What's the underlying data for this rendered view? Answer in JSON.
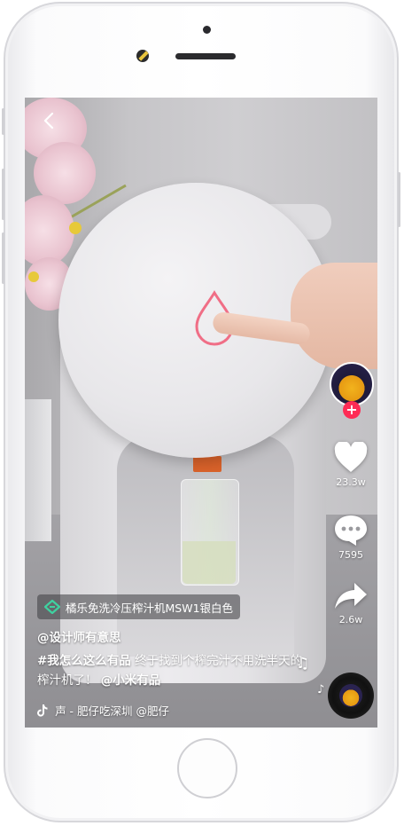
{
  "video": {
    "product_tag": "橘乐免洗冷压榨汁机MSW1银白色",
    "author": "@设计师有意思",
    "caption": {
      "hashtag": "#我怎么这么有品",
      "text": " 终于找到个榨完汁不用洗半天的榨汁机了！",
      "mention": "@小米有品"
    },
    "music": " 声 - 肥仔吃深圳   @肥仔 "
  },
  "actions": {
    "likes": "23.3w",
    "comments": "7595",
    "shares": "2.6w"
  },
  "colors": {
    "follow_badge": "#fe2c55",
    "product_icon": "#3fd1a0"
  },
  "icons": [
    "back-chevron-icon",
    "heart-icon",
    "comment-icon",
    "share-icon",
    "link-icon",
    "tiktok-logo-icon",
    "music-note-icon"
  ]
}
